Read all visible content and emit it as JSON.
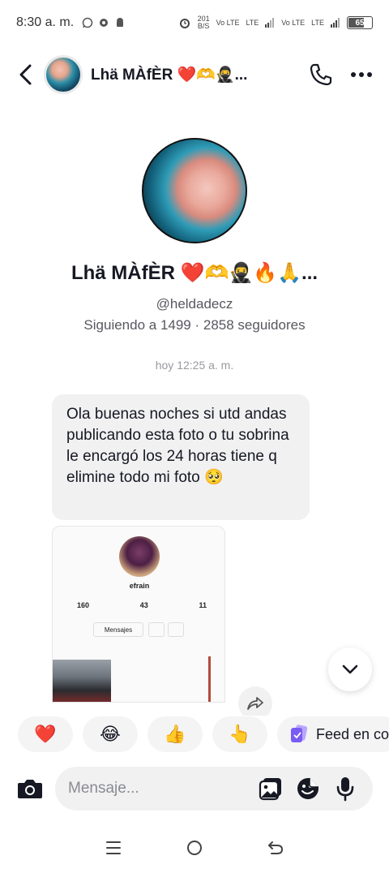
{
  "status_bar": {
    "time": "8:30 a. m.",
    "net_speed": "201",
    "net_unit": "B/S",
    "signal_1": "Vo LTE",
    "signal_2": "LTE",
    "signal_3": "Vo LTE",
    "signal_4": "LTE",
    "battery": "65"
  },
  "header": {
    "contact_name": "Lhä MÀfÈR ❤️🫶🥷..."
  },
  "profile": {
    "name": "Lhä MÀfÈR ❤️🫶🥷🔥🙏...",
    "handle": "@heldadecz",
    "stats": "Siguiendo a 1499 · 2858 seguidores"
  },
  "conversation": {
    "timestamp": "hoy 12:25 a. m.",
    "message": "Ola buenas noches si utd andas publicando esta foto o tu sobrina le encargó los 24 horas tiene q elimine todo mi foto 🥺",
    "shared_image": {
      "name": "efrain",
      "stats": [
        "160",
        "43",
        "11"
      ],
      "button_label": "Mensajes"
    }
  },
  "reactions": {
    "items": [
      "❤️",
      "😂",
      "👍",
      "👆"
    ],
    "feed_label": "Feed en co"
  },
  "input": {
    "placeholder": "Mensaje..."
  },
  "colors": {
    "accent_purple": "#7a5cf5",
    "bubble_bg": "#f1f1f2",
    "text_primary": "#161823",
    "text_secondary": "#57575f"
  }
}
